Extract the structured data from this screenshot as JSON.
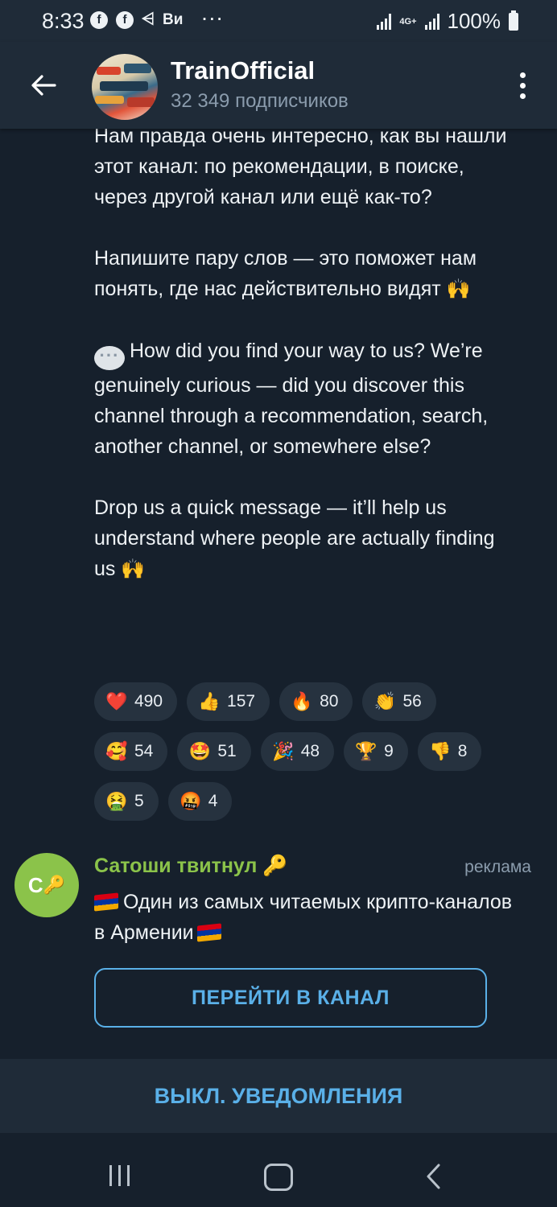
{
  "status_bar": {
    "time": "8:33",
    "notif_icons": [
      "facebook-icon",
      "facebook-icon",
      "rss-icon",
      "vk-icon"
    ],
    "vk_label": "Ви",
    "more": "···",
    "network": "4G+",
    "battery": "100%"
  },
  "header": {
    "title": "TrainOfficial",
    "subtitle": "32 349 подписчиков"
  },
  "message": {
    "ru_para1": "Нам правда очень интересно, как вы нашли этот канал: по рекомендации, в поиске, через другой канал или ещё как-то?",
    "ru_para2": "Напишите пару слов — это поможет нам понять, где нас действительно видят",
    "en_para1": "How did you find your way to us? We’re genuinely curious — did you discover this channel through a recommendation, search, another channel, or somewhere else?",
    "en_para2": "Drop us a quick message — it’ll help us understand where people are actually finding us",
    "emoji_hands": "🙌"
  },
  "reactions": [
    {
      "icon": "❤️",
      "name": "heart",
      "count": "490"
    },
    {
      "icon": "👍",
      "name": "thumbs-up",
      "count": "157"
    },
    {
      "icon": "🔥",
      "name": "fire",
      "count": "80"
    },
    {
      "icon": "👏",
      "name": "clap",
      "count": "56"
    },
    {
      "icon": "🥰",
      "name": "smiling-hearts",
      "count": "54"
    },
    {
      "icon": "🤩",
      "name": "star-struck",
      "count": "51"
    },
    {
      "icon": "🎉",
      "name": "party-popper",
      "count": "48"
    },
    {
      "icon": "🏆",
      "name": "trophy",
      "count": "9"
    },
    {
      "icon": "👎",
      "name": "thumbs-down",
      "count": "8"
    },
    {
      "icon": "🤮",
      "name": "vomiting",
      "count": "5"
    },
    {
      "icon": "🤬",
      "name": "cursing",
      "count": "4"
    }
  ],
  "sponsored": {
    "avatar_letter": "С",
    "avatar_emoji": "🔑",
    "title": "Сатоши твитнул 🔑",
    "label": "реклама",
    "text": "Один из самых читаемых крипто-каналов в Армении",
    "button": "ПЕРЕЙТИ В КАНАЛ"
  },
  "bottom": {
    "mute": "ВЫКЛ. УВЕДОМЛЕНИЯ"
  },
  "colors": {
    "background": "#16202c",
    "bar": "#1f2b38",
    "accent": "#5ab0e8",
    "sponsor_green": "#8bc34a",
    "reaction_bg": "#26323f"
  }
}
